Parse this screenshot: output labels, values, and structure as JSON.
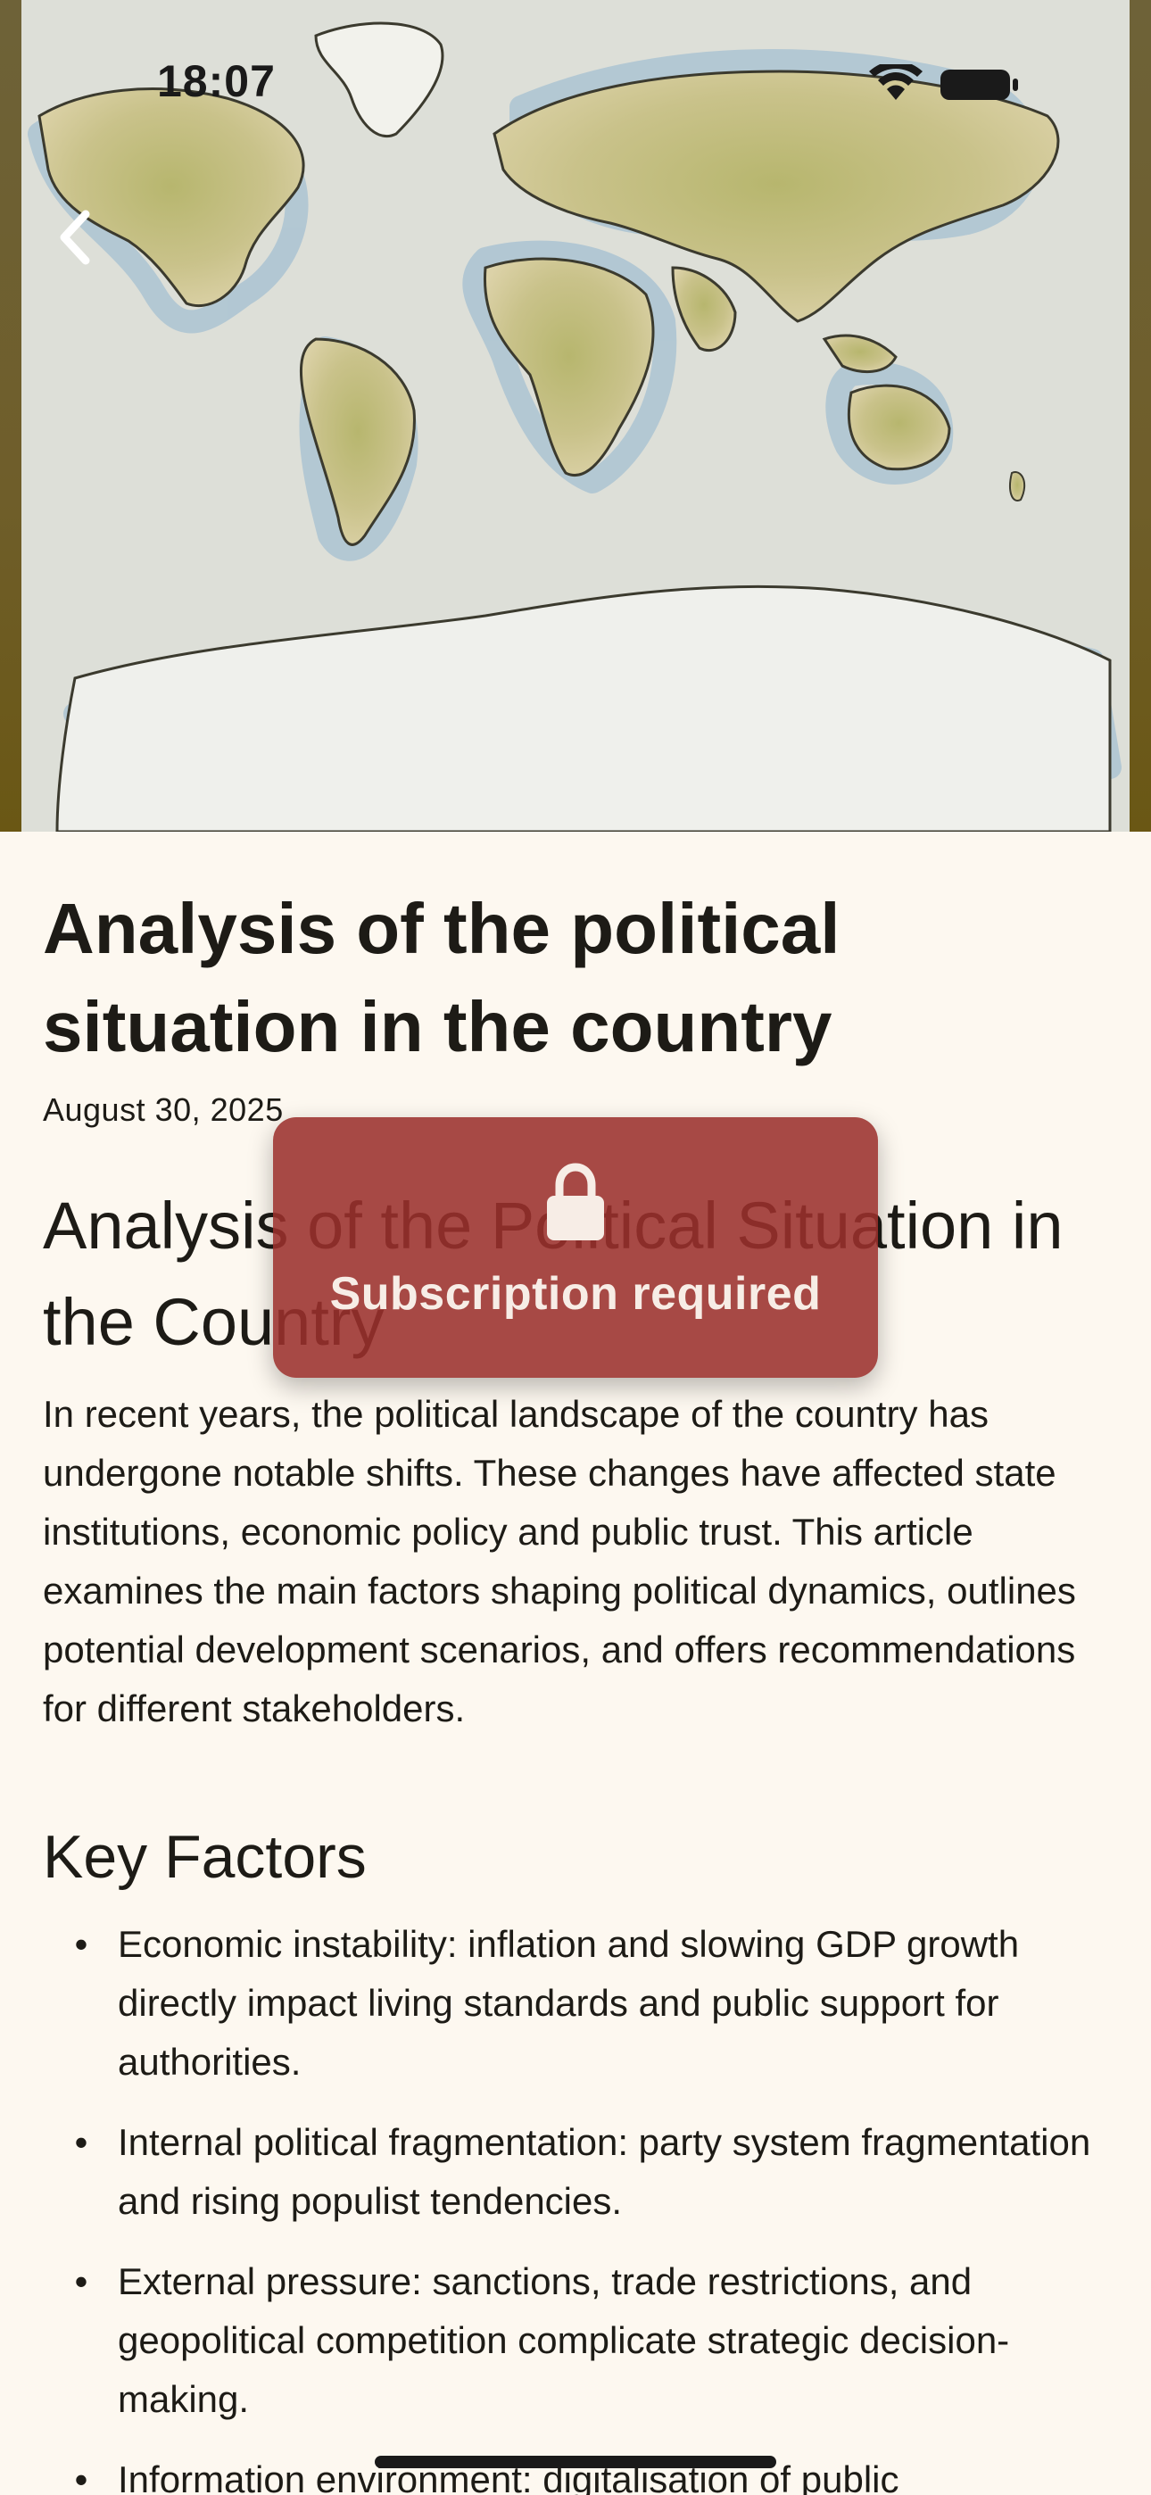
{
  "status_bar": {
    "time": "18:07",
    "icons": [
      "wifi-icon",
      "battery-icon"
    ]
  },
  "nav": {
    "back_icon": "chevron-left-icon"
  },
  "article": {
    "title": "Analysis of the political situation in the country",
    "date": "August 30, 2025",
    "body_heading": "Analysis of the Political Situation in the Country",
    "paragraph": "In recent years, the political landscape of the country has undergone notable shifts. These changes have affected state institutions, economic policy and public trust. This article examines the main factors shaping political dynamics, outlines potential development scenarios, and offers recommendations for different stakeholders.",
    "section_heading": "Key Factors",
    "bullet_symbol": "•",
    "factors": [
      "Economic instability: inflation and slowing GDP growth directly impact living standards and public support for authorities.",
      "Internal political fragmentation: party system fragmentation and rising populist tendencies.",
      "External pressure: sanctions, trade restrictions, and geopolitical competition complicate strategic decision-making.",
      "Information environment: digitalisation of public"
    ]
  },
  "paywall": {
    "icon": "lock-icon",
    "label": "Subscription required"
  },
  "colors": {
    "background": "#FDF8F0",
    "text": "#1D1B16",
    "paywall": "#9B302C",
    "paywall_text": "#F7EDE6"
  }
}
